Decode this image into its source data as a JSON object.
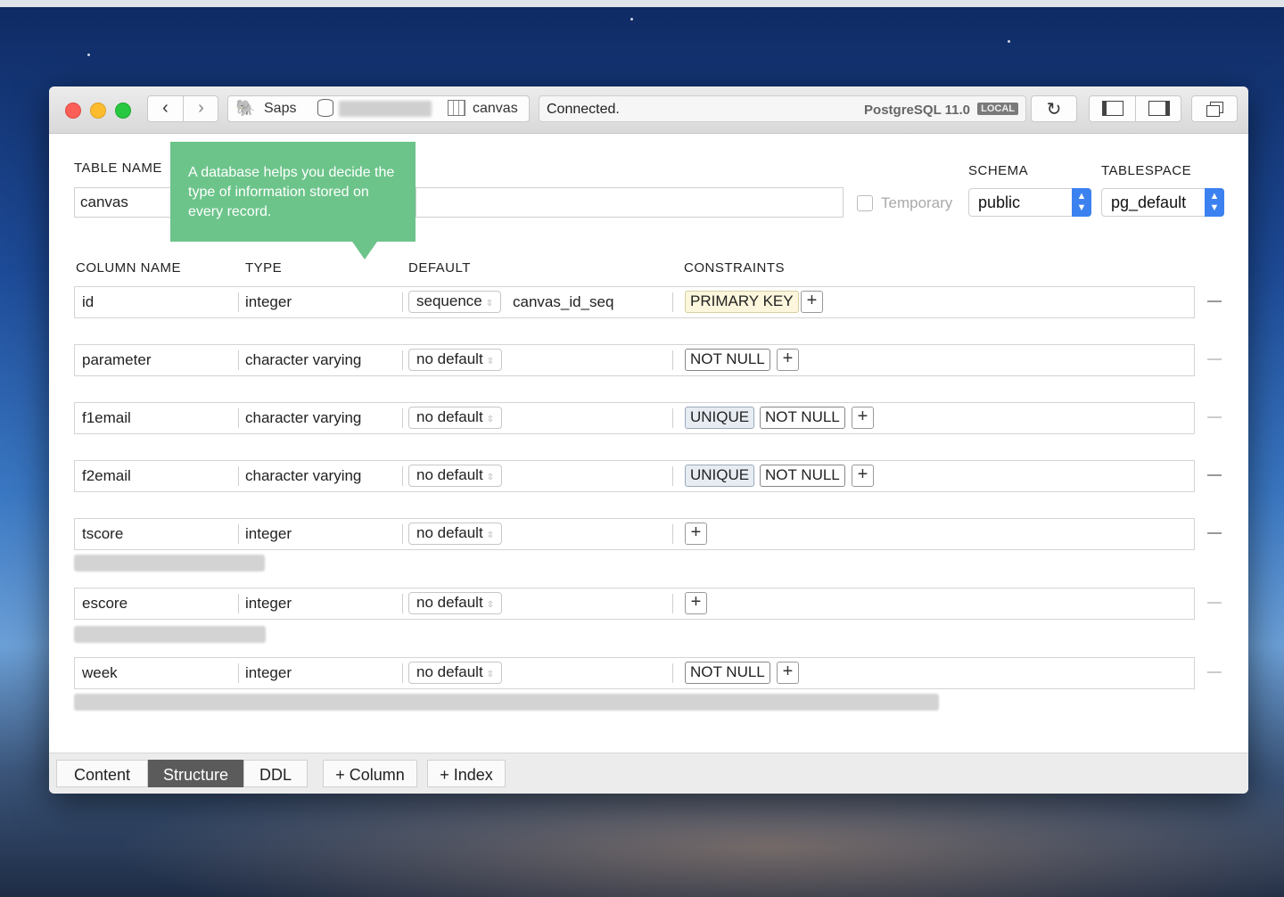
{
  "window": {
    "toolbar": {
      "connection_name": "Saps",
      "table_tab": "canvas",
      "status": "Connected.",
      "server": "PostgreSQL 11.0",
      "server_badge": "LOCAL"
    }
  },
  "form": {
    "table_name_label": "TABLE NAME",
    "table_name_value": "canvas",
    "comment_value": "",
    "temporary_label": "Temporary",
    "schema_label": "SCHEMA",
    "schema_value": "public",
    "tablespace_label": "TABLESPACE",
    "tablespace_value": "pg_default"
  },
  "tooltip": {
    "text": "A database helps you decide the type of information stored on every record."
  },
  "columns_header": {
    "name": "COLUMN NAME",
    "type": "TYPE",
    "default": "DEFAULT",
    "constraints": "CONSTRAINTS"
  },
  "rows": [
    {
      "name": "id",
      "type": "integer",
      "default": "sequence",
      "default_extra": "canvas_id_seq",
      "constraints": [
        "PRIMARY KEY"
      ]
    },
    {
      "name": "parameter",
      "type": "character varying",
      "default": "no default",
      "default_extra": "",
      "constraints": [
        "NOT NULL"
      ]
    },
    {
      "name": "f1email",
      "type": "character varying",
      "default": "no default",
      "default_extra": "",
      "constraints": [
        "UNIQUE",
        "NOT NULL"
      ]
    },
    {
      "name": "f2email",
      "type": "character varying",
      "default": "no default",
      "default_extra": "",
      "constraints": [
        "UNIQUE",
        "NOT NULL"
      ]
    },
    {
      "name": "tscore",
      "type": "integer",
      "default": "no default",
      "default_extra": "",
      "constraints": []
    },
    {
      "name": "escore",
      "type": "integer",
      "default": "no default",
      "default_extra": "",
      "constraints": []
    },
    {
      "name": "week",
      "type": "integer",
      "default": "no default",
      "default_extra": "",
      "constraints": [
        "NOT NULL"
      ]
    }
  ],
  "bottom": {
    "tab_content": "Content",
    "tab_structure": "Structure",
    "tab_ddl": "DDL",
    "add_column": "+ Column",
    "add_index": "+ Index"
  },
  "colors": {
    "tooltip_green": "#6cc48a",
    "select_blue": "#3b82f0",
    "active_tab": "#5b5b5b",
    "primary_key_bg": "#fbf6dc",
    "unique_bg": "#e7ecf3"
  }
}
